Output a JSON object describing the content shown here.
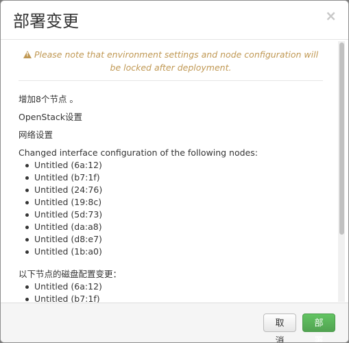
{
  "modal": {
    "title": "部署变更",
    "close_label": "×"
  },
  "alert": {
    "icon": "warning-icon",
    "text": "Please note that environment settings and node configuration will be locked after deployment."
  },
  "changes": {
    "add_nodes": "增加8个节点 。",
    "openstack_settings": "OpenStack设置",
    "network_settings": "网络设置",
    "interface_header": "Changed interface configuration of the following nodes:",
    "interface_nodes": [
      "Untitled (6a:12)",
      "Untitled (b7:1f)",
      "Untitled (24:76)",
      "Untitled (19:8c)",
      "Untitled (5d:73)",
      "Untitled (da:a8)",
      "Untitled (d8:e7)",
      "Untitled (1b:a0)"
    ],
    "disk_header": "以下节点的磁盘配置变更：",
    "disk_nodes": [
      "Untitled (6a:12)",
      "Untitled (b7:1f)"
    ]
  },
  "footer": {
    "cancel_label": "取消",
    "deploy_label": "部署"
  },
  "colors": {
    "warning": "#c09853",
    "deploy_button": "#5bb75b"
  }
}
